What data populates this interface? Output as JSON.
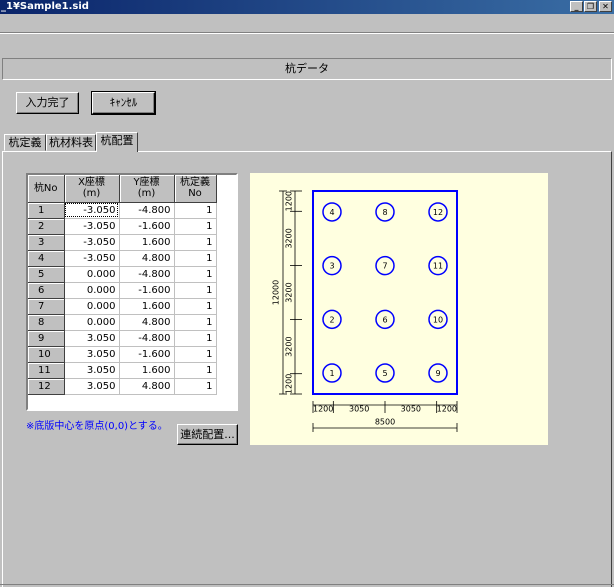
{
  "window": {
    "title": "_1¥Sample1.sid",
    "min_glyph": "_",
    "restore_glyph": "❐",
    "close_glyph": "✕"
  },
  "panel": {
    "title": "杭データ"
  },
  "buttons": {
    "input_done": "入力完了",
    "cancel": "ｷｬﾝｾﾙ",
    "continuous": "連続配置..."
  },
  "tabs": [
    {
      "label": "杭定義",
      "active": false
    },
    {
      "label": "杭材料表",
      "active": false
    },
    {
      "label": "杭配置",
      "active": true
    }
  ],
  "grid": {
    "headers": [
      "杭No",
      "X座標\n(m)",
      "Y座標\n(m)",
      "杭定義\nNo"
    ],
    "rows": [
      {
        "no": "1",
        "x": "-3.050",
        "y": "-4.800",
        "def": "1"
      },
      {
        "no": "2",
        "x": "-3.050",
        "y": "-1.600",
        "def": "1"
      },
      {
        "no": "3",
        "x": "-3.050",
        "y": "1.600",
        "def": "1"
      },
      {
        "no": "4",
        "x": "-3.050",
        "y": "4.800",
        "def": "1"
      },
      {
        "no": "5",
        "x": "0.000",
        "y": "-4.800",
        "def": "1"
      },
      {
        "no": "6",
        "x": "0.000",
        "y": "-1.600",
        "def": "1"
      },
      {
        "no": "7",
        "x": "0.000",
        "y": "1.600",
        "def": "1"
      },
      {
        "no": "8",
        "x": "0.000",
        "y": "4.800",
        "def": "1"
      },
      {
        "no": "9",
        "x": "3.050",
        "y": "-4.800",
        "def": "1"
      },
      {
        "no": "10",
        "x": "3.050",
        "y": "-1.600",
        "def": "1"
      },
      {
        "no": "11",
        "x": "3.050",
        "y": "1.600",
        "def": "1"
      },
      {
        "no": "12",
        "x": "3.050",
        "y": "4.800",
        "def": "1"
      }
    ]
  },
  "note": "※底版中心を原点(0,0)とする。",
  "diagram": {
    "line_color": "#0000ff",
    "bottom_dims": [
      "1200",
      "3050",
      "3050",
      "1200"
    ],
    "bottom_total": "8500",
    "left_dims": [
      "1200",
      "3200",
      "3200",
      "3200",
      "1200"
    ],
    "left_total": "12000",
    "piles": [
      {
        "label": "1",
        "x": -3.05,
        "y": -4.8
      },
      {
        "label": "2",
        "x": -3.05,
        "y": -1.6
      },
      {
        "label": "3",
        "x": -3.05,
        "y": 1.6
      },
      {
        "label": "4",
        "x": -3.05,
        "y": 4.8
      },
      {
        "label": "5",
        "x": 0.0,
        "y": -4.8
      },
      {
        "label": "6",
        "x": 0.0,
        "y": -1.6
      },
      {
        "label": "7",
        "x": 0.0,
        "y": 1.6
      },
      {
        "label": "8",
        "x": 0.0,
        "y": 4.8
      },
      {
        "label": "9",
        "x": 3.05,
        "y": -4.8
      },
      {
        "label": "10",
        "x": 3.05,
        "y": -1.6
      },
      {
        "label": "11",
        "x": 3.05,
        "y": 1.6
      },
      {
        "label": "12",
        "x": 3.05,
        "y": 4.8
      }
    ]
  }
}
